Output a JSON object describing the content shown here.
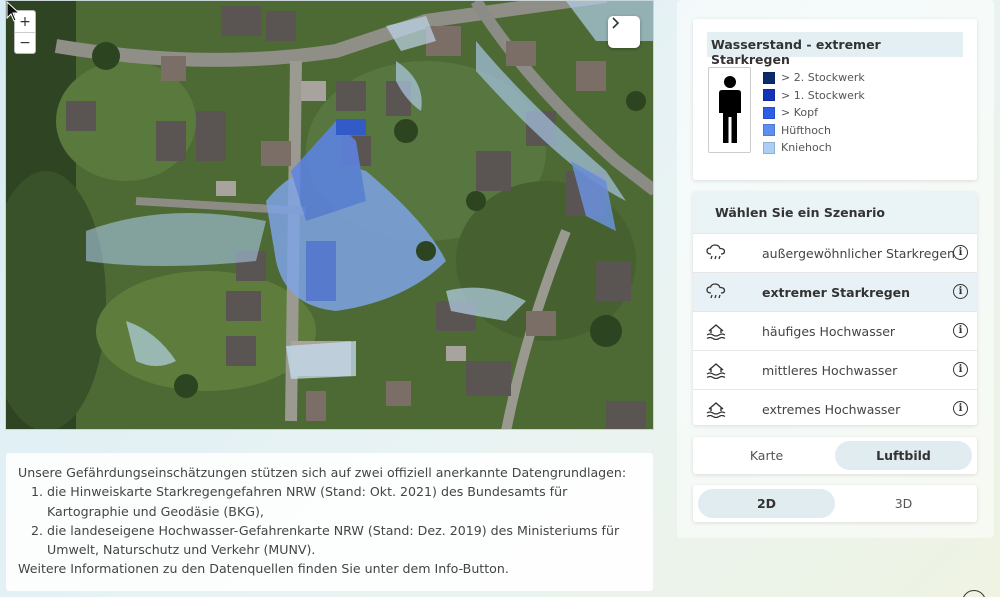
{
  "map": {
    "zoom_in_label": "+",
    "zoom_out_label": "−",
    "expand_icon": "chevron-right-icon"
  },
  "info": {
    "intro": "Unsere Gefährdungseinschätzungen stützen sich auf zwei offiziell anerkannte Datengrundlagen:",
    "items": [
      "die Hinweiskarte Starkregengefahren NRW (Stand: Okt. 2021) des Bundesamts für Kartographie und Geodäsie (BKG),",
      "die landeseigene Hochwasser-Gefahrenkarte NRW (Stand: Dez. 2019) des Ministeriums für Umwelt, Naturschutz und Verkehr (MUNV)."
    ],
    "outro": "Weitere Informationen zu den Datenquellen finden Sie unter dem Info-Button."
  },
  "legend": {
    "title": "Wasserstand - extremer Starkregen",
    "items": [
      {
        "label": "> 2. Stockwerk",
        "color": "#0b2a6b"
      },
      {
        "label": "> 1. Stockwerk",
        "color": "#1433b8"
      },
      {
        "label": "> Kopf",
        "color": "#2c5fe8"
      },
      {
        "label": "Hüfthoch",
        "color": "#5c8ff0"
      },
      {
        "label": "Kniehoch",
        "color": "#a9d0f3"
      }
    ]
  },
  "scenarios": {
    "header": "Wählen Sie ein Szenario",
    "items": [
      {
        "label": "außergewöhnlicher Starkregen",
        "icon": "rain-cloud-icon",
        "selected": false
      },
      {
        "label": "extremer Starkregen",
        "icon": "rain-cloud-icon",
        "selected": true
      },
      {
        "label": "häufiges Hochwasser",
        "icon": "flood-house-icon",
        "selected": false
      },
      {
        "label": "mittleres Hochwasser",
        "icon": "flood-house-icon",
        "selected": false
      },
      {
        "label": "extremes Hochwasser",
        "icon": "flood-house-icon",
        "selected": false
      }
    ],
    "info_label": "i"
  },
  "basemap_toggle": {
    "options": [
      "Karte",
      "Luftbild"
    ],
    "active": "Luftbild"
  },
  "view_toggle": {
    "options": [
      "2D",
      "3D"
    ],
    "active": "2D"
  }
}
